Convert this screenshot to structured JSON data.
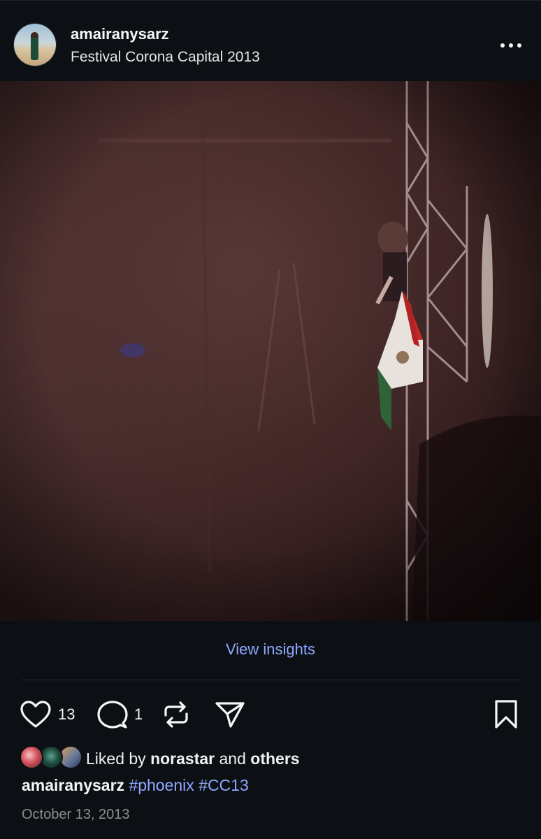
{
  "post": {
    "username": "amairanysarz",
    "location": "Festival Corona Capital 2013"
  },
  "insights_label": "View insights",
  "actions": {
    "like_count": "13",
    "comment_count": "1"
  },
  "likes": {
    "prefix": "Liked by",
    "user": "norastar",
    "connector": "and",
    "others": "others"
  },
  "caption": {
    "username": "amairanysarz",
    "hashtags": [
      "#phoenix",
      "#CC13"
    ]
  },
  "date": "October 13, 2013",
  "icons": {
    "more": "more-options-icon",
    "like": "heart-icon",
    "comment": "comment-bubble-icon",
    "repost": "repost-icon",
    "share": "send-icon",
    "save": "bookmark-icon"
  },
  "colors": {
    "background": "#0c1014",
    "link": "#8fa8ff",
    "muted": "#8e8e8e"
  }
}
